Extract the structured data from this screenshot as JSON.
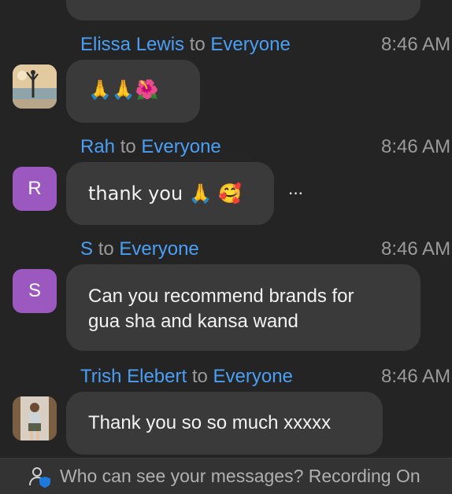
{
  "messages": [
    {
      "sender": "Elissa Lewis",
      "to_word": "to",
      "recipient": "Everyone",
      "time": "8:46 AM",
      "text": "🙏🙏🌺"
    },
    {
      "sender": "Rah",
      "to_word": "to",
      "recipient": "Everyone",
      "time": "8:46 AM",
      "avatar_letter": "R",
      "text": "thank you 🙏 🥰"
    },
    {
      "sender": "S",
      "to_word": "to",
      "recipient": "Everyone",
      "time": "8:46 AM",
      "avatar_letter": "S",
      "text_line1": "Can you recommend brands for",
      "text_line2": "gua sha and kansa wand"
    },
    {
      "sender": "Trish Elebert",
      "to_word": "to",
      "recipient": "Everyone",
      "time": "8:46 AM",
      "text": "Thank you so so much xxxxx"
    }
  ],
  "more_button": "···",
  "footer": {
    "icon": "person-shield-icon",
    "text": "Who can see your messages? Recording On"
  },
  "colors": {
    "background": "#242424",
    "bubble": "#3a3a3a",
    "name": "#4a9ff5",
    "muted": "#9a9a9a",
    "avatar_letter_bg": "#9b59c0"
  }
}
